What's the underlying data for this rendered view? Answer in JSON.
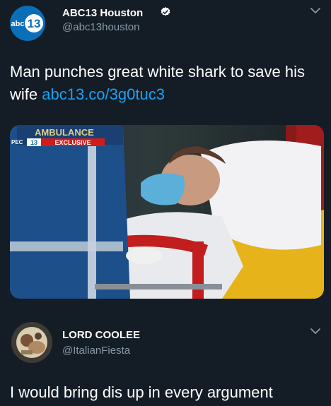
{
  "tweet_main": {
    "display_name": "ABC13 Houston",
    "handle": "@abc13houston",
    "text": "Man punches great white shark to save his wife ",
    "link_text": "abc13.co/3g0tuc3",
    "avatar_logo_text": "abc13",
    "media": {
      "overlay_text": "AMBULANCE",
      "badge_channel": "13",
      "badge_label": "EXCLUSIVE",
      "corner_text": "PEC"
    }
  },
  "tweet_reply": {
    "display_name": "LORD COOLEE",
    "handle": "@ItalianFiesta",
    "text": "I would bring dis up in every argument"
  },
  "icons": [
    "verified-badge-icon",
    "chevron-down-icon",
    "avatar"
  ],
  "colors": {
    "background": "#141d26",
    "link": "#1da1f2",
    "handle": "#8899a6",
    "abc_brand": "#0a6fb8"
  }
}
